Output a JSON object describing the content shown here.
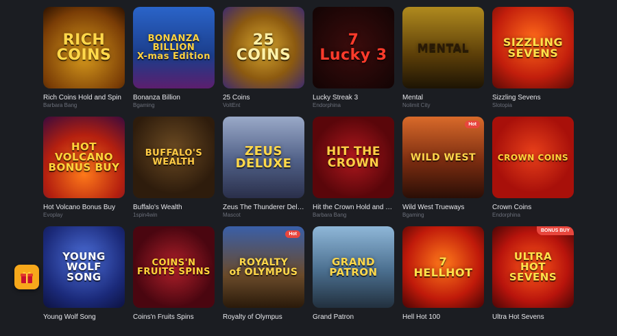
{
  "games": [
    {
      "name": "Rich Coins Hold and Spin",
      "provider": "Barbara Bang",
      "art": "RICH\nCOINS",
      "bg": "radial-gradient(circle at 50% 60%, #d79a1c, #7a3d06 70%, #2b1202)",
      "fg": "#ffd84a",
      "size": 22
    },
    {
      "name": "Bonanza Billion",
      "provider": "Bgaming",
      "art": "BONANZA\nBILLION\nX-mas Edition",
      "bg": "linear-gradient(180deg,#2a64c9,#1b3d8a 60%,#5c1e6e)",
      "fg": "#ffd23f",
      "size": 13
    },
    {
      "name": "25 Coins",
      "provider": "VoltEnt",
      "art": "25\nCOINS",
      "bg": "radial-gradient(circle at 50% 50%, #d8a830, #8c5a10 55%, #3d2a6e)",
      "fg": "#fff1a8",
      "size": 22
    },
    {
      "name": "Lucky Streak 3",
      "provider": "Endorphina",
      "art": "7\nLucky 3",
      "bg": "radial-gradient(circle at 50% 50%, #3c0c0c, #120404)",
      "fg": "#ff3b2b",
      "size": 22
    },
    {
      "name": "Mental",
      "provider": "Nolimit City",
      "art": "MENTAL",
      "bg": "linear-gradient(180deg,#b08a1e,#5a3d08 60%,#1d1404)",
      "fg": "#2a1a06",
      "size": 16
    },
    {
      "name": "Sizzling Sevens",
      "provider": "Slotopia",
      "art": "SIZZLING\nSEVENS",
      "bg": "radial-gradient(circle at 50% 40%, #ff6a1a, #c21e0c 60%, #5c0a06)",
      "fg": "#ffe14a",
      "size": 16
    },
    {
      "name": "Hot Volcano Bonus Buy",
      "provider": "Evoplay",
      "art": "HOT\nVOLCANO\nBONUS BUY",
      "bg": "radial-gradient(circle at 50% 70%, #ff7a1a, #b5200f 55%, #3a0a3d)",
      "fg": "#ffd43a",
      "size": 15
    },
    {
      "name": "Buffalo's Wealth",
      "provider": "1spin4win",
      "art": "BUFFALO'S\nWEALTH",
      "bg": "radial-gradient(circle at 50% 40%, #6b4a22, #2e1c0c 70%)",
      "fg": "#ffcb45",
      "size": 13
    },
    {
      "name": "Zeus The Thunderer Deluxe",
      "provider": "Mascot",
      "art": "ZEUS\nDELUXE",
      "bg": "linear-gradient(180deg,#9aa9c8,#4f5f86 55%,#2a2f4a)",
      "fg": "#ffd84a",
      "size": 18
    },
    {
      "name": "Hit the Crown Hold and Spin",
      "provider": "Barbara Bang",
      "art": "HIT THE\nCROWN",
      "bg": "radial-gradient(circle at 50% 50%, #b0181e, #5a060a 70%)",
      "fg": "#ffcf45",
      "size": 17
    },
    {
      "name": "Wild West Trueways",
      "provider": "Bgaming",
      "art": "WILD WEST",
      "bg": "linear-gradient(180deg,#d96a2a,#7a2c10 55%,#2a0e06)",
      "fg": "#ffd64a",
      "size": 14,
      "badge": "Hot"
    },
    {
      "name": "Crown Coins",
      "provider": "Endorphina",
      "art": "CROWN COINS",
      "bg": "radial-gradient(circle at 50% 45%, #e8401a, #a8100a 65%)",
      "fg": "#ffd43a",
      "size": 12
    },
    {
      "name": "Young Wolf Song",
      "provider": "",
      "art": "YOUNG\nWOLF\nSONG",
      "bg": "radial-gradient(circle at 50% 40%, #4c6ed8, #1b2a7a 65%, #0d1240)",
      "fg": "#ffffff",
      "size": 15
    },
    {
      "name": "Coins'n Fruits Spins",
      "provider": "",
      "art": "COINS'N\nFRUITS SPINS",
      "bg": "radial-gradient(circle at 50% 50%, #b0202a, #4a0610 70%)",
      "fg": "#ffd43a",
      "size": 13
    },
    {
      "name": "Royalty of Olympus",
      "provider": "",
      "art": "ROYALTY\nof OLYMPUS",
      "bg": "linear-gradient(180deg,#3a5fa8,#6a4a2a 60%,#2a1a0a)",
      "fg": "#ffd84a",
      "size": 14,
      "badge": "Hot"
    },
    {
      "name": "Grand Patron",
      "provider": "",
      "art": "GRAND\nPATRON",
      "bg": "linear-gradient(180deg,#8fb7d8,#4a6e8e 55%,#22303e)",
      "fg": "#ffd84a",
      "size": 15
    },
    {
      "name": "Hell Hot 100",
      "provider": "",
      "art": "7\nHELLHOT",
      "bg": "radial-gradient(circle at 50% 45%, #ff7a1a, #c01a0a 60%, #4a0404)",
      "fg": "#ffe14a",
      "size": 16
    },
    {
      "name": "Ultra Hot Sevens",
      "provider": "",
      "art": "ULTRA\nHOT\nSEVENS",
      "bg": "radial-gradient(circle at 50% 50%, #ff5a1a, #b8140c 60%, #4a0606)",
      "fg": "#ffe14a",
      "size": 15,
      "badge": "BONUS BUY",
      "badgeBonus": true
    }
  ],
  "gift_icon": "gift-icon",
  "colors": {
    "background": "#1b1d22",
    "gift": "#f7a81b",
    "badge": "#e8463d"
  }
}
